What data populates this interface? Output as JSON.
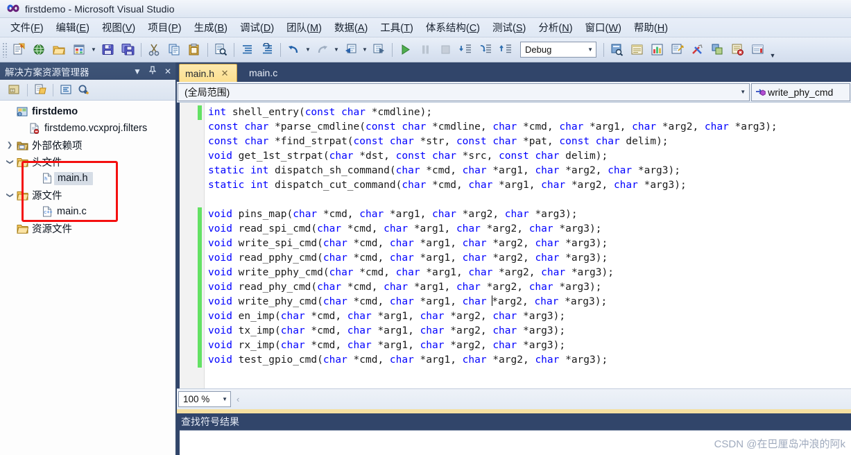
{
  "window": {
    "title": "firstdemo - Microsoft Visual Studio",
    "logo_icon": "visual-studio-infinity-icon"
  },
  "menubar": {
    "items": [
      {
        "label": "文件(F)",
        "accel": "F"
      },
      {
        "label": "编辑(E)",
        "accel": "E"
      },
      {
        "label": "视图(V)",
        "accel": "V"
      },
      {
        "label": "项目(P)",
        "accel": "P"
      },
      {
        "label": "生成(B)",
        "accel": "B"
      },
      {
        "label": "调试(D)",
        "accel": "D"
      },
      {
        "label": "团队(M)",
        "accel": "M"
      },
      {
        "label": "数据(A)",
        "accel": "A"
      },
      {
        "label": "工具(T)",
        "accel": "T"
      },
      {
        "label": "体系结构(C)",
        "accel": "C"
      },
      {
        "label": "测试(S)",
        "accel": "S"
      },
      {
        "label": "分析(N)",
        "accel": "N"
      },
      {
        "label": "窗口(W)",
        "accel": "W"
      },
      {
        "label": "帮助(H)",
        "accel": "H"
      }
    ]
  },
  "toolbar": {
    "config_value": "Debug",
    "buttons": [
      "new-project-icon",
      "add-web-site-icon",
      "open-file-icon",
      "add-new-item-icon",
      "save-icon",
      "save-all-icon",
      "cut-icon",
      "copy-icon",
      "paste-icon",
      "find-in-files-icon",
      "comment-lines-icon",
      "uncomment-lines-icon",
      "undo-icon",
      "redo-icon",
      "navigate-backward-icon",
      "navigate-forward-icon",
      "start-debugging-icon",
      "pause-icon",
      "stop-icon",
      "step-into-icon",
      "step-over-icon",
      "step-out-icon",
      "solution-explorer-icon",
      "properties-window-icon",
      "object-browser-icon",
      "toolbox-icon",
      "tools-options-icon",
      "class-view-icon",
      "error-list-icon",
      "output-window-icon"
    ],
    "overflow_icon": "toolbar-overflow-icon"
  },
  "solution_explorer": {
    "title": "解决方案资源管理器",
    "header_icons": [
      "dropdown-icon",
      "pin-icon",
      "close-icon"
    ],
    "toolbar_icons": [
      "properties-icon",
      "show-all-files-icon",
      "view-code-icon",
      "refresh-icon"
    ],
    "tree": [
      {
        "label": "firstdemo",
        "icon": "project-icon",
        "indent": 0,
        "expander": "",
        "bold": true,
        "selected": false
      },
      {
        "label": "firstdemo.vcxproj.filters",
        "icon": "filters-file-icon",
        "indent": 1,
        "expander": "",
        "bold": false,
        "selected": false
      },
      {
        "label": "外部依赖项",
        "icon": "folder-ext-icon",
        "indent": 0,
        "expander": "collapsed",
        "bold": false,
        "selected": false
      },
      {
        "label": "头文件",
        "icon": "folder-open-icon",
        "indent": 0,
        "expander": "expanded",
        "bold": false,
        "selected": false
      },
      {
        "label": "main.h",
        "icon": "header-file-icon",
        "indent": 2,
        "expander": "",
        "bold": false,
        "selected": true
      },
      {
        "label": "源文件",
        "icon": "folder-open-icon",
        "indent": 0,
        "expander": "expanded",
        "bold": false,
        "selected": false
      },
      {
        "label": "main.c",
        "icon": "c-file-icon",
        "indent": 2,
        "expander": "",
        "bold": false,
        "selected": false
      },
      {
        "label": "资源文件",
        "icon": "folder-open-icon",
        "indent": 0,
        "expander": "",
        "bold": false,
        "selected": false
      }
    ],
    "annotation": {
      "shape": "rectangle",
      "color": "#f41010"
    }
  },
  "editor": {
    "tabs": [
      {
        "label": "main.h",
        "active": true,
        "close_icon": "close-tab-icon"
      },
      {
        "label": "main.c",
        "active": false,
        "close_icon": ""
      }
    ],
    "nav_scope": "(全局范围)",
    "nav_member": "write_phy_cmd",
    "nav_member_icon": "method-icon",
    "zoom": "100 %",
    "lines": [
      {
        "changed": true,
        "tokens": [
          [
            "kw",
            "int"
          ],
          [
            "txt",
            " shell_entry("
          ],
          [
            "kw",
            "const char"
          ],
          [
            "txt",
            " *cmdline);"
          ]
        ]
      },
      {
        "changed": false,
        "tokens": [
          [
            "kw",
            "const char"
          ],
          [
            "txt",
            " *parse_cmdline("
          ],
          [
            "kw",
            "const char"
          ],
          [
            "txt",
            " *cmdline, "
          ],
          [
            "kw",
            "char"
          ],
          [
            "txt",
            " *cmd, "
          ],
          [
            "kw",
            "char"
          ],
          [
            "txt",
            " *arg1, "
          ],
          [
            "kw",
            "char"
          ],
          [
            "txt",
            " *arg2, "
          ],
          [
            "kw",
            "char"
          ],
          [
            "txt",
            " *arg3);"
          ]
        ]
      },
      {
        "changed": false,
        "tokens": [
          [
            "kw",
            "const char"
          ],
          [
            "txt",
            " *find_strpat("
          ],
          [
            "kw",
            "const char"
          ],
          [
            "txt",
            " *str, "
          ],
          [
            "kw",
            "const char"
          ],
          [
            "txt",
            " *pat, "
          ],
          [
            "kw",
            "const char"
          ],
          [
            "txt",
            " delim);"
          ]
        ]
      },
      {
        "changed": false,
        "tokens": [
          [
            "kw",
            "void"
          ],
          [
            "txt",
            " get_1st_strpat("
          ],
          [
            "kw",
            "char"
          ],
          [
            "txt",
            " *dst, "
          ],
          [
            "kw",
            "const char"
          ],
          [
            "txt",
            " *src, "
          ],
          [
            "kw",
            "const char"
          ],
          [
            "txt",
            " delim);"
          ]
        ]
      },
      {
        "changed": false,
        "tokens": [
          [
            "kw",
            "static int"
          ],
          [
            "txt",
            " dispatch_sh_command("
          ],
          [
            "kw",
            "char"
          ],
          [
            "txt",
            " *cmd, "
          ],
          [
            "kw",
            "char"
          ],
          [
            "txt",
            " *arg1, "
          ],
          [
            "kw",
            "char"
          ],
          [
            "txt",
            " *arg2, "
          ],
          [
            "kw",
            "char"
          ],
          [
            "txt",
            " *arg3);"
          ]
        ]
      },
      {
        "changed": false,
        "tokens": [
          [
            "kw",
            "static int"
          ],
          [
            "txt",
            " dispatch_cut_command("
          ],
          [
            "kw",
            "char"
          ],
          [
            "txt",
            " *cmd, "
          ],
          [
            "kw",
            "char"
          ],
          [
            "txt",
            " *arg1, "
          ],
          [
            "kw",
            "char"
          ],
          [
            "txt",
            " *arg2, "
          ],
          [
            "kw",
            "char"
          ],
          [
            "txt",
            " *arg3);"
          ]
        ]
      },
      {
        "changed": false,
        "tokens": []
      },
      {
        "changed": true,
        "tokens": [
          [
            "kw",
            "void"
          ],
          [
            "txt",
            " pins_map("
          ],
          [
            "kw",
            "char"
          ],
          [
            "txt",
            " *cmd, "
          ],
          [
            "kw",
            "char"
          ],
          [
            "txt",
            " *arg1, "
          ],
          [
            "kw",
            "char"
          ],
          [
            "txt",
            " *arg2, "
          ],
          [
            "kw",
            "char"
          ],
          [
            "txt",
            " *arg3);"
          ]
        ]
      },
      {
        "changed": true,
        "tokens": [
          [
            "kw",
            "void"
          ],
          [
            "txt",
            " read_spi_cmd("
          ],
          [
            "kw",
            "char"
          ],
          [
            "txt",
            " *cmd, "
          ],
          [
            "kw",
            "char"
          ],
          [
            "txt",
            " *arg1, "
          ],
          [
            "kw",
            "char"
          ],
          [
            "txt",
            " *arg2, "
          ],
          [
            "kw",
            "char"
          ],
          [
            "txt",
            " *arg3);"
          ]
        ]
      },
      {
        "changed": true,
        "tokens": [
          [
            "kw",
            "void"
          ],
          [
            "txt",
            " write_spi_cmd("
          ],
          [
            "kw",
            "char"
          ],
          [
            "txt",
            " *cmd, "
          ],
          [
            "kw",
            "char"
          ],
          [
            "txt",
            " *arg1, "
          ],
          [
            "kw",
            "char"
          ],
          [
            "txt",
            " *arg2, "
          ],
          [
            "kw",
            "char"
          ],
          [
            "txt",
            " *arg3);"
          ]
        ]
      },
      {
        "changed": true,
        "tokens": [
          [
            "kw",
            "void"
          ],
          [
            "txt",
            " read_pphy_cmd("
          ],
          [
            "kw",
            "char"
          ],
          [
            "txt",
            " *cmd, "
          ],
          [
            "kw",
            "char"
          ],
          [
            "txt",
            " *arg1, "
          ],
          [
            "kw",
            "char"
          ],
          [
            "txt",
            " *arg2, "
          ],
          [
            "kw",
            "char"
          ],
          [
            "txt",
            " *arg3);"
          ]
        ]
      },
      {
        "changed": true,
        "tokens": [
          [
            "kw",
            "void"
          ],
          [
            "txt",
            " write_pphy_cmd("
          ],
          [
            "kw",
            "char"
          ],
          [
            "txt",
            " *cmd, "
          ],
          [
            "kw",
            "char"
          ],
          [
            "txt",
            " *arg1, "
          ],
          [
            "kw",
            "char"
          ],
          [
            "txt",
            " *arg2, "
          ],
          [
            "kw",
            "char"
          ],
          [
            "txt",
            " *arg3);"
          ]
        ]
      },
      {
        "changed": true,
        "tokens": [
          [
            "kw",
            "void"
          ],
          [
            "txt",
            " read_phy_cmd("
          ],
          [
            "kw",
            "char"
          ],
          [
            "txt",
            " *cmd, "
          ],
          [
            "kw",
            "char"
          ],
          [
            "txt",
            " *arg1, "
          ],
          [
            "kw",
            "char"
          ],
          [
            "txt",
            " *arg2, "
          ],
          [
            "kw",
            "char"
          ],
          [
            "txt",
            " *arg3);"
          ]
        ]
      },
      {
        "changed": true,
        "caret_after": 6,
        "tokens": [
          [
            "kw",
            "void"
          ],
          [
            "txt",
            " write_phy_cmd("
          ],
          [
            "kw",
            "char"
          ],
          [
            "txt",
            " *cmd, "
          ],
          [
            "kw",
            "char"
          ],
          [
            "txt",
            " *arg1, "
          ],
          [
            "kw",
            "char"
          ],
          [
            "txt",
            " "
          ],
          [
            "caret",
            ""
          ],
          [
            "txt",
            "*arg2, "
          ],
          [
            "kw",
            "char"
          ],
          [
            "txt",
            " *arg3);"
          ]
        ]
      },
      {
        "changed": true,
        "tokens": [
          [
            "kw",
            "void"
          ],
          [
            "txt",
            " en_imp("
          ],
          [
            "kw",
            "char"
          ],
          [
            "txt",
            " *cmd, "
          ],
          [
            "kw",
            "char"
          ],
          [
            "txt",
            " *arg1, "
          ],
          [
            "kw",
            "char"
          ],
          [
            "txt",
            " *arg2, "
          ],
          [
            "kw",
            "char"
          ],
          [
            "txt",
            " *arg3);"
          ]
        ]
      },
      {
        "changed": true,
        "tokens": [
          [
            "kw",
            "void"
          ],
          [
            "txt",
            " tx_imp("
          ],
          [
            "kw",
            "char"
          ],
          [
            "txt",
            " *cmd, "
          ],
          [
            "kw",
            "char"
          ],
          [
            "txt",
            " *arg1, "
          ],
          [
            "kw",
            "char"
          ],
          [
            "txt",
            " *arg2, "
          ],
          [
            "kw",
            "char"
          ],
          [
            "txt",
            " *arg3);"
          ]
        ]
      },
      {
        "changed": true,
        "tokens": [
          [
            "kw",
            "void"
          ],
          [
            "txt",
            " rx_imp("
          ],
          [
            "kw",
            "char"
          ],
          [
            "txt",
            " *cmd, "
          ],
          [
            "kw",
            "char"
          ],
          [
            "txt",
            " *arg1, "
          ],
          [
            "kw",
            "char"
          ],
          [
            "txt",
            " *arg2, "
          ],
          [
            "kw",
            "char"
          ],
          [
            "txt",
            " *arg3);"
          ]
        ]
      },
      {
        "changed": true,
        "tokens": [
          [
            "kw",
            "void"
          ],
          [
            "txt",
            " test_gpio_cmd("
          ],
          [
            "kw",
            "char"
          ],
          [
            "txt",
            " *cmd, "
          ],
          [
            "kw",
            "char"
          ],
          [
            "txt",
            " *arg1, "
          ],
          [
            "kw",
            "char"
          ],
          [
            "txt",
            " *arg2, "
          ],
          [
            "kw",
            "char"
          ],
          [
            "txt",
            " *arg3);"
          ]
        ]
      }
    ]
  },
  "bottom_pane": {
    "title": "查找符号结果"
  },
  "watermark": {
    "text": "CSDN @在巴厘岛冲浪的阿k"
  },
  "colors": {
    "chrome_dark": "#31456a",
    "keyword_blue": "#0000ff",
    "change_bar_green": "#64e164",
    "annotation_red": "#f41010",
    "active_tab_gold": "#fcdf8f"
  }
}
